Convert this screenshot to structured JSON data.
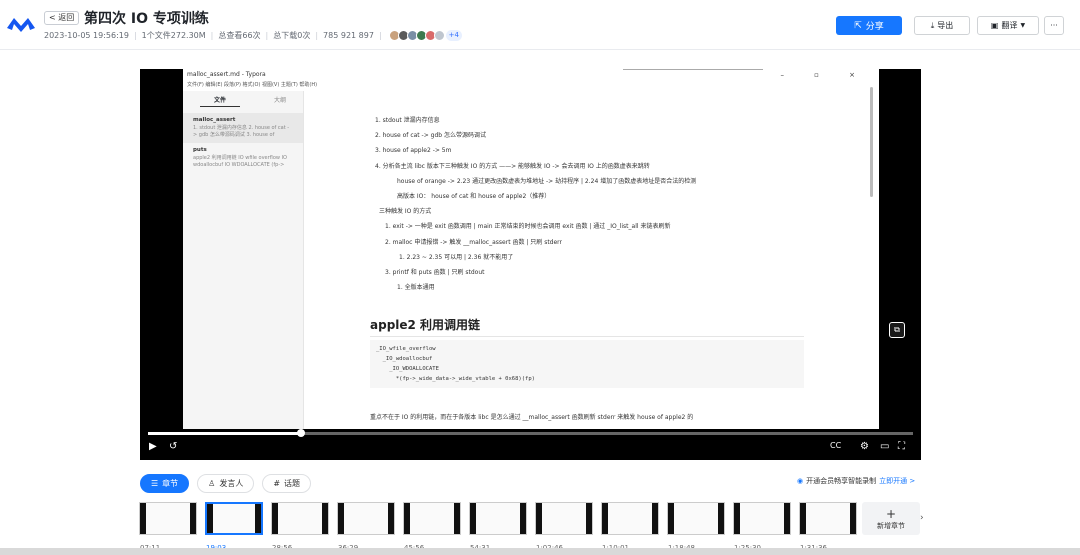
{
  "header": {
    "back_label": "< 返回",
    "title": "第四次 IO 专项训练",
    "meta": {
      "datetime": "2023-10-05 19:56:19",
      "files": "1个文件272.30M",
      "views": "总查看66次",
      "downloads": "总下载0次",
      "group_id": "785 921 897"
    },
    "avatars_more": "+4",
    "avatar_colors": [
      "#c9a27e",
      "#5b5b5b",
      "#7a8fa6",
      "#3d7a4f",
      "#d96a6a",
      "#bfc6cf"
    ],
    "share_label": "分享",
    "export_label": "导出",
    "translate_label": "翻译",
    "more_label": "···"
  },
  "video": {
    "app_title": "malloc_assert.md - Typora",
    "app_menu": "文件(F)  编辑(E)  段落(P)  格式(O)  视图(V)  主题(T)  帮助(H)",
    "window_controls": "–  ▫  ×",
    "sidebar": {
      "tab_files": "文件",
      "tab_outline": "大纲",
      "files": [
        {
          "name": "malloc_assert",
          "desc": "1. stdout 泄漏内存信息 2. house of cat -> gdb 怎么带源码调试 3. house of"
        },
        {
          "name": "puts",
          "desc": "apple2 利用调用链 IO wfile overflow IO wdoallocbuf IO WDOALLOCATE (fp->"
        }
      ]
    },
    "doc_lines": [
      {
        "cls": "l1",
        "text": "1. stdout 泄漏内存信息"
      },
      {
        "cls": "l1",
        "text": "2. house of cat -> gdb 怎么带源码调试"
      },
      {
        "cls": "l1",
        "text": "3. house of apple2 -> 5m"
      },
      {
        "cls": "l1",
        "text": "4. 分析各主流 libc 版本下三种触发 IO 的方式 ——> 能够触发 IO -> 会去调用 IO 上的函数虚表来跳转"
      },
      {
        "cls": "l2",
        "text": "house of orange -> 2.23 通过更改函数虚表为堆地址 -> 劫持程序 | 2.24 增加了函数虚表地址是否合法的检测"
      },
      {
        "cls": "l2",
        "text": "高版本 IO： house of cat 和 house of apple2（推荐）"
      },
      {
        "cls": "l3",
        "text": "三种触发 IO 的方式"
      },
      {
        "cls": "l4",
        "text": "1. exit -> 一种是 exit 函数调用 | main 正常结束的时候也会调用 exit 函数 | 通过 _IO_list_all 来链表刷新"
      },
      {
        "cls": "l4",
        "text": "2. malloc 申请报错 -> 触发 __malloc_assert 函数 | 只刷 stderr"
      },
      {
        "cls": "l5",
        "text": "1. 2.23 ~ 2.35 可以用 | 2.36 就不能用了"
      },
      {
        "cls": "l4",
        "text": "3. printf 和 puts 函数 | 只刷 stdout"
      },
      {
        "cls": "l6",
        "text": "1. 全版本通用"
      }
    ],
    "heading": "apple2 利用调用链",
    "code": "_IO_wfile_overflow\n  _IO_wdoallocbuf\n    _IO_WDOALLOCATE\n      *(fp->_wide_data->_wide_vtable + 0x68)(fp)",
    "tail_text": "重点不在于 IO 的利用链，而在于各版本 libc 是怎么通过 __malloc_assert 函数刷新 stderr 来触发 house of apple2 的",
    "progress": 0.2
  },
  "tabs": [
    {
      "label": "章节",
      "icon": "list-icon",
      "active": true
    },
    {
      "label": "发言人",
      "icon": "user-icon",
      "active": false
    },
    {
      "label": "话题",
      "icon": "hash-icon",
      "active": false
    }
  ],
  "promo": {
    "text": "开通会员畅享智能录制",
    "link": "立即开通 >"
  },
  "chapters": [
    {
      "time": "07:11"
    },
    {
      "time": "19:03",
      "selected": true
    },
    {
      "time": "28:56"
    },
    {
      "time": "36:29"
    },
    {
      "time": "45:56"
    },
    {
      "time": "54:31"
    },
    {
      "time": "1:02:46"
    },
    {
      "time": "1:10:01"
    },
    {
      "time": "1:18:48"
    },
    {
      "time": "1:25:30"
    },
    {
      "time": "1:31:36"
    }
  ],
  "add_chapter": {
    "plus": "+",
    "label": "新增章节"
  }
}
